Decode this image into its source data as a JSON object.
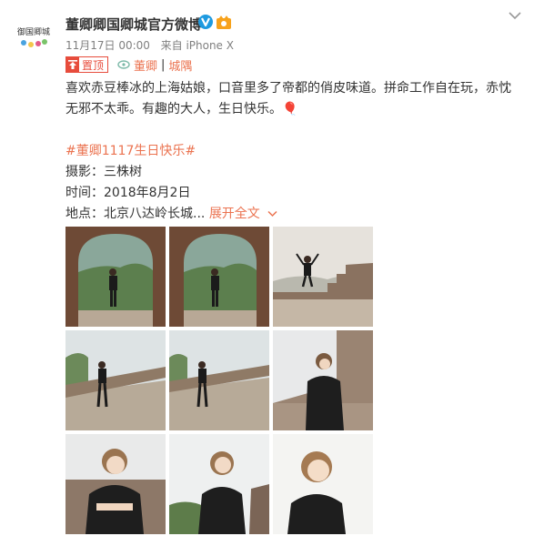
{
  "post": {
    "avatar_text": "御国卿城",
    "author": "董卿卿国卿城官方微博",
    "time": "11月17日 00:00",
    "source_prefix": "来自",
    "source": "iPhone X",
    "tags": {
      "top_label": "置顶",
      "link_label": "董卿",
      "divider": "|",
      "group_label": "城隅"
    },
    "text_line1": "喜欢赤豆棒冰的上海姑娘，口音里多了帝都的俏皮味道。拼命工作自在玩，赤忱",
    "text_line2": "无邪不太乖。有趣的大人，生日快乐。🎈",
    "hashtag": "#董卿1117生日快乐#",
    "credit": "摄影：三株树",
    "date_line": "时间：2018年8月2日",
    "location_line": "地点：北京八达岭长城...",
    "expand_label": "展开全文",
    "photos": [
      {
        "subject": "woman-in-arch-standing"
      },
      {
        "subject": "woman-in-arch-standing"
      },
      {
        "subject": "woman-jumping-on-wall"
      },
      {
        "subject": "woman-walking-on-wall"
      },
      {
        "subject": "woman-walking-on-wall"
      },
      {
        "subject": "woman-leaning-on-wall"
      },
      {
        "subject": "woman-portrait-arms-crossed"
      },
      {
        "subject": "woman-portrait-looking-up"
      },
      {
        "subject": "woman-portrait-smiling"
      }
    ]
  },
  "colors": {
    "accent": "#eb7350",
    "pin_red": "#e74c3c",
    "verified_blue": "#1e9ae0",
    "meta_gray": "#808080"
  }
}
